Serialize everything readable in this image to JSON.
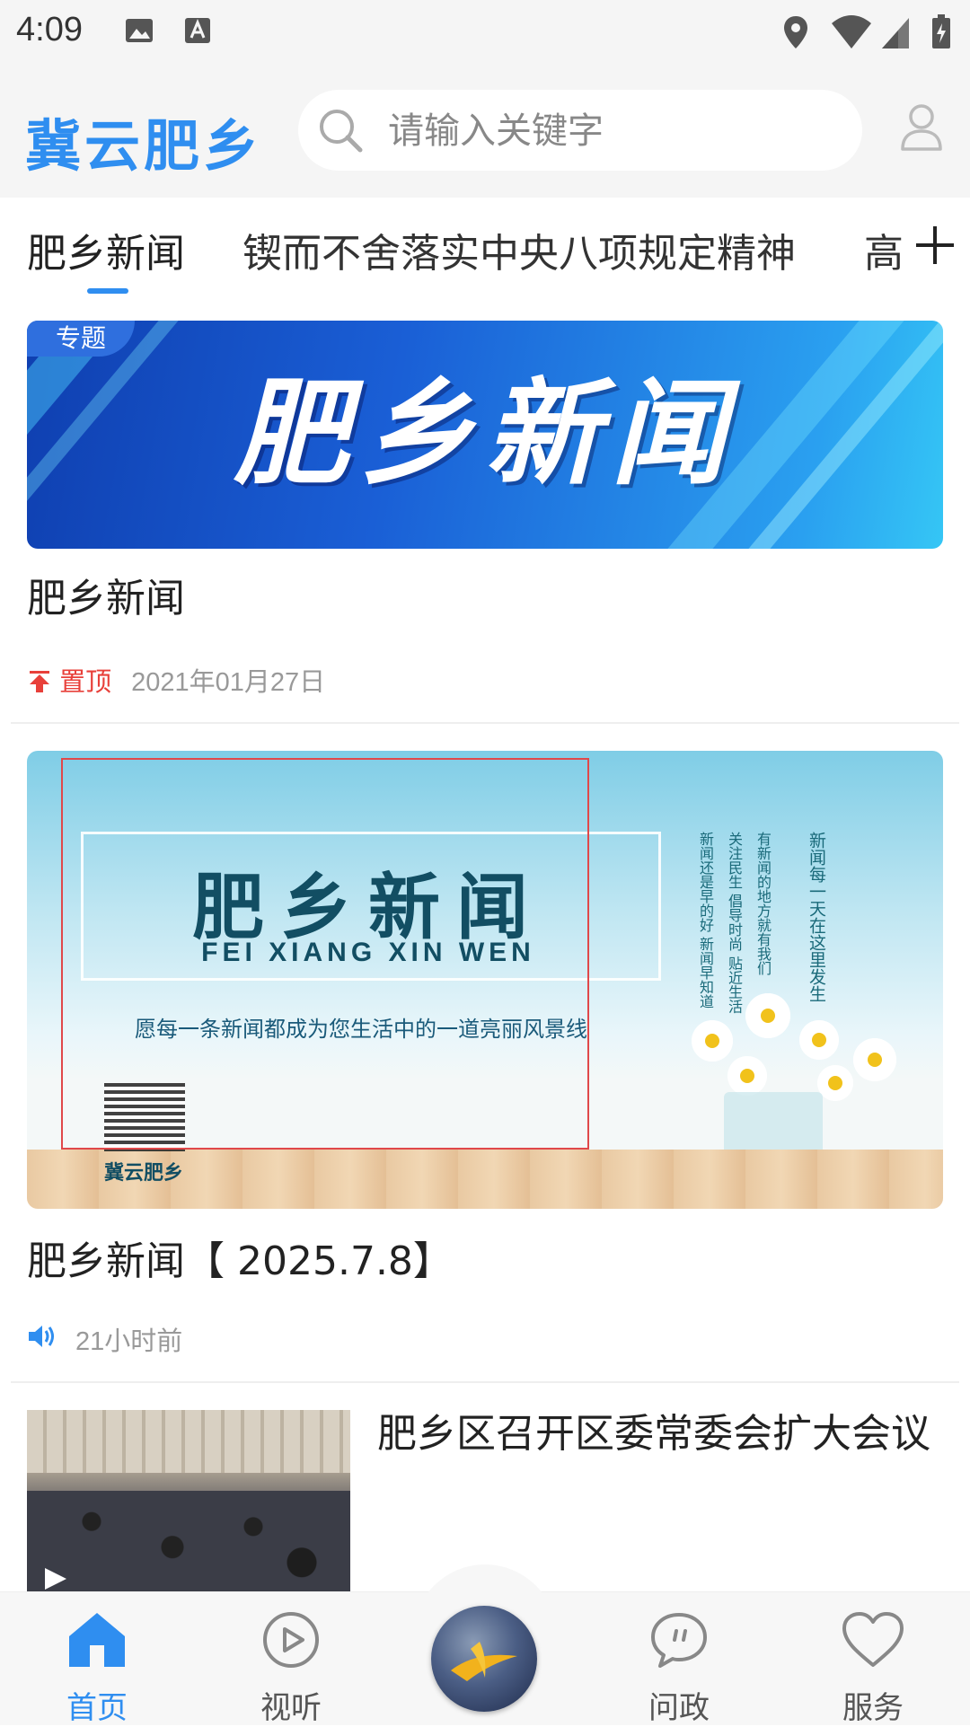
{
  "status_bar": {
    "time": "4:09"
  },
  "header": {
    "brand": "冀云肥乡",
    "search": {
      "placeholder": "请输入关键字"
    }
  },
  "tabs": [
    {
      "label": "肥乡新闻",
      "active": true
    },
    {
      "label": "锲而不舍落实中央八项规定精神",
      "active": false
    },
    {
      "label": "高",
      "active": false
    }
  ],
  "feed": [
    {
      "banner_tag": "专题",
      "banner_text": "肥乡新闻",
      "title": "肥乡新闻",
      "pin_label": "置顶",
      "date": "2021年01月27日"
    },
    {
      "banner_title": "肥乡新闻",
      "banner_subtitle": "FEI XIANG XIN WEN",
      "banner_slogan": "愿每一条新闻都成为您生活中的一道亮丽风景线",
      "banner_qr_label": "冀云肥乡",
      "banner_vertical": [
        "新闻每一天在这里发生",
        "有新闻的地方就有我们",
        "关注民生 倡导时尚 贴近生活",
        "新闻还是早的好 新闻早知道"
      ],
      "title": "肥乡新闻【 2025.7.8】",
      "time_ago": "21小时前"
    },
    {
      "title": "肥乡区召开区委常委会扩大会议"
    }
  ],
  "bottom_nav": [
    {
      "label": "首页",
      "icon": "home-icon",
      "active": true
    },
    {
      "label": "视听",
      "icon": "play-circle-icon",
      "active": false
    },
    {
      "label": "",
      "icon": "center-logo",
      "active": false
    },
    {
      "label": "问政",
      "icon": "chat-bubble-icon",
      "active": false
    },
    {
      "label": "服务",
      "icon": "heart-icon",
      "active": false
    }
  ],
  "colors": {
    "accent": "#2f8ef0",
    "pin": "#e8403a"
  }
}
